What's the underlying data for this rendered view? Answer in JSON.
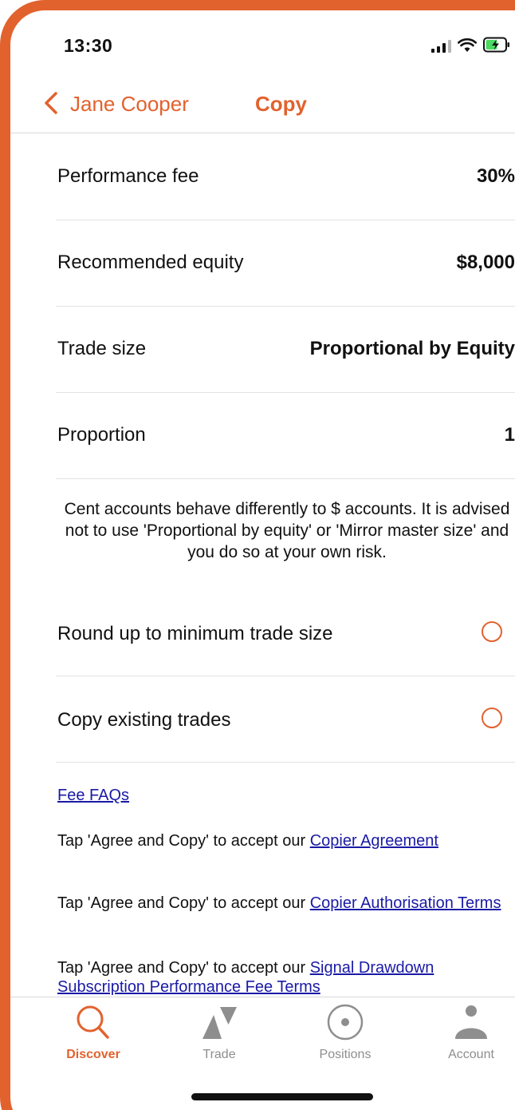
{
  "status_bar": {
    "time": "13:30"
  },
  "nav": {
    "back_label": "Jane Cooper",
    "title": "Copy"
  },
  "settings": {
    "rows": [
      {
        "label": "Performance fee",
        "value": "30%"
      },
      {
        "label": "Recommended equity",
        "value": "$8,000"
      },
      {
        "label": "Trade size",
        "value": "Proportional by Equity"
      },
      {
        "label": "Proportion",
        "value": "1"
      }
    ]
  },
  "warning_text": "Cent accounts behave differently to $ accounts. It is advised not to use 'Proportional by equity' or 'Mirror master size' and you do so at your own risk.",
  "options": [
    {
      "label": "Round up to minimum trade size",
      "selected": false
    },
    {
      "label": "Copy existing trades",
      "selected": false
    }
  ],
  "links": {
    "fee_faqs": "Fee FAQs",
    "terms": [
      {
        "prefix": "Tap 'Agree and Copy' to accept our ",
        "link": "Copier Agreement"
      },
      {
        "prefix": "Tap 'Agree and Copy' to accept our ",
        "link": "Copier Authorisation Terms"
      },
      {
        "prefix": "Tap 'Agree and Copy' to accept our ",
        "link": "Signal Drawdown Subscription Performance Fee Terms"
      }
    ]
  },
  "tabbar": {
    "tabs": [
      {
        "label": "Discover",
        "icon": "search-icon",
        "active": true
      },
      {
        "label": "Trade",
        "icon": "trade-icon",
        "active": false
      },
      {
        "label": "Positions",
        "icon": "positions-icon",
        "active": false
      },
      {
        "label": "Account",
        "icon": "account-icon",
        "active": false
      }
    ]
  },
  "colors": {
    "accent": "#e2622e",
    "link": "#1a1aa6",
    "inactive_tab": "#8e8e8e"
  }
}
